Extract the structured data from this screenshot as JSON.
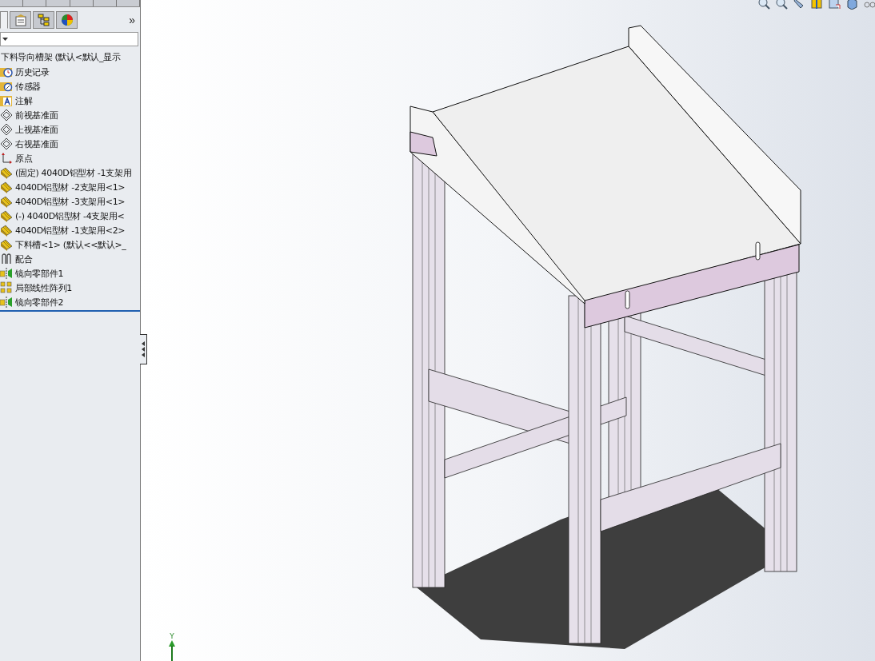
{
  "panel_tabs": [
    {
      "kind": "feature",
      "selected": true
    },
    {
      "kind": "property",
      "selected": false
    },
    {
      "kind": "configuration",
      "selected": false
    },
    {
      "kind": "display",
      "selected": false
    }
  ],
  "panel_more": "»",
  "tree": {
    "label": "下料导向槽架  (默认<默认_显示",
    "children": [
      {
        "kind": "history",
        "label": "历史记录"
      },
      {
        "kind": "sensor",
        "label": "传感器"
      },
      {
        "kind": "annotation",
        "label": "注解"
      },
      {
        "kind": "plane",
        "label": "前视基准面"
      },
      {
        "kind": "plane",
        "label": "上视基准面"
      },
      {
        "kind": "plane",
        "label": "右视基准面"
      },
      {
        "kind": "origin",
        "label": "原点"
      },
      {
        "kind": "part",
        "label": "(固定) 4040D铝型材 -1支架用"
      },
      {
        "kind": "part",
        "label": "4040D铝型材 -2支架用<1>"
      },
      {
        "kind": "part",
        "label": "4040D铝型材 -3支架用<1>"
      },
      {
        "kind": "part",
        "label": "(-) 4040D铝型材 -4支架用<"
      },
      {
        "kind": "part",
        "label": "4040D铝型材 -1支架用<2>"
      },
      {
        "kind": "part",
        "label": "下料槽<1> (默认<<默认>_"
      },
      {
        "kind": "mates",
        "label": "配合"
      },
      {
        "kind": "mirror",
        "label": "镜向零部件1"
      },
      {
        "kind": "pattern",
        "label": "局部线性阵列1"
      },
      {
        "kind": "mirror",
        "label": "镜向零部件2"
      }
    ]
  },
  "triad": {
    "axis_label": "Y"
  }
}
